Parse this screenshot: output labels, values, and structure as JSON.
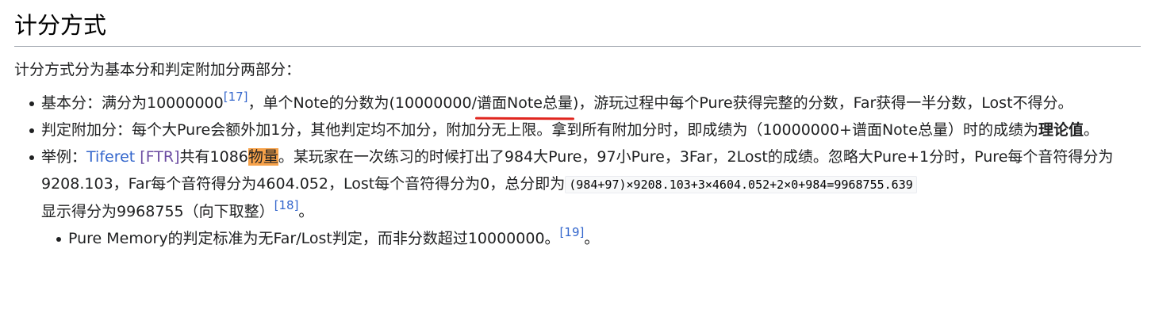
{
  "section": {
    "heading": "计分方式",
    "intro": "计分方式分为基本分和判定附加分两部分："
  },
  "items": {
    "basic": {
      "lead": "基本分：满分为10000000",
      "ref1": "[17]",
      "mid": "，单个Note的分数为(10000000/",
      "underlined": "谱面Note总量",
      "tail": ")，游玩过程中每个Pure获得完整的分数，Far获得一半分数，Lost不得分。"
    },
    "bonus": {
      "text": "判定附加分：每个大Pure会额外加1分，其他判定均不加分，附加分无上限。拿到所有附加分时，即成绩为（10000000+谱面Note总量）时的成绩为",
      "bold": "理论值",
      "end": "。"
    },
    "example": {
      "lead": "举例：",
      "song_link": "Tiferet",
      "difficulty_link": "[FTR]",
      "count_text": "共有1086",
      "highlighted": "物量",
      "body": "。某玩家在一次练习的时候打出了984大Pure，97小Pure，3Far，2Lost的成绩。忽略大Pure+1分时，Pure每个音符得分为9208.103，Far每个音符得分为4604.052，Lost每个音符得分为0，总分即为",
      "formula": "(984+97)×9208.103+3×4604.052+2×0+984=9968755.639",
      "display": "显示得分为9968755（向下取整）",
      "ref": "[18]",
      "end": "。"
    },
    "sub": {
      "text": "Pure Memory的判定标准为无Far/Lost判定，而非分数超过10000000。",
      "ref": "[19]",
      "end": "。"
    }
  }
}
